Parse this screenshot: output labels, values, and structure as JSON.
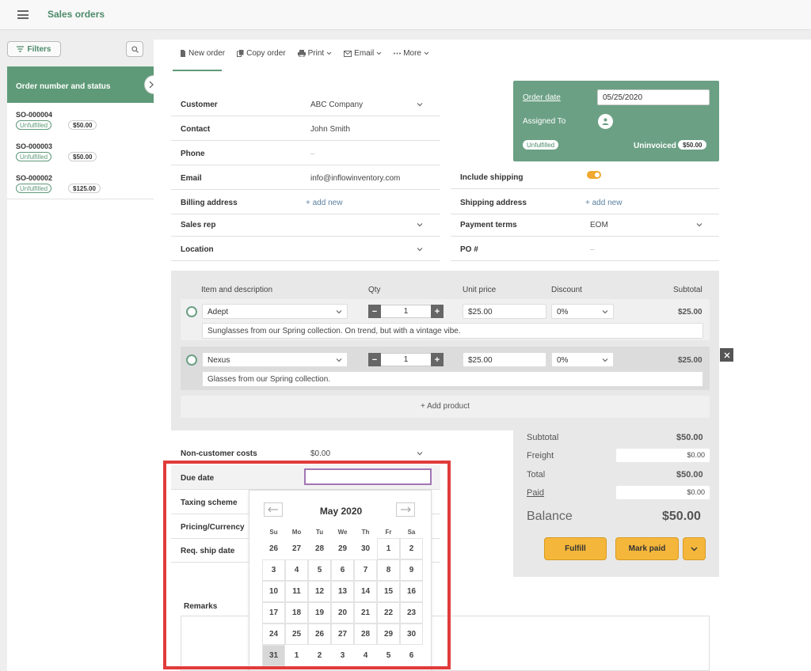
{
  "app": {
    "title": "Sales orders"
  },
  "sidebar": {
    "filters_label": "Filters",
    "list_header": "Order number and status",
    "orders": [
      {
        "number": "SO-000004",
        "status": "Unfulfilled",
        "amount": "$50.00"
      },
      {
        "number": "SO-000003",
        "status": "Unfulfilled",
        "amount": "$50.00"
      },
      {
        "number": "SO-000002",
        "status": "Unfulfilled",
        "amount": "$125.00"
      }
    ]
  },
  "toolbar": {
    "new_order": "New order",
    "copy_order": "Copy order",
    "print": "Print",
    "email": "Email",
    "more": "More"
  },
  "form": {
    "customer_label": "Customer",
    "customer_value": "ABC Company",
    "contact_label": "Contact",
    "contact_value": "John Smith",
    "phone_label": "Phone",
    "phone_value": "–",
    "email_label": "Email",
    "email_value": "info@inflowinventory.com",
    "billing_label": "Billing address",
    "billing_value": "+ add new",
    "salesrep_label": "Sales rep",
    "location_label": "Location",
    "include_shipping_label": "Include shipping",
    "shipping_label": "Shipping address",
    "shipping_value": "+ add new",
    "payment_terms_label": "Payment terms",
    "payment_terms_value": "EOM",
    "po_label": "PO #",
    "po_value": "–"
  },
  "order_box": {
    "order_date_label": "Order date",
    "order_date_value": "05/25/2020",
    "assigned_label": "Assigned To",
    "status": "Unfulfilled",
    "invoice_status": "Uninvoiced",
    "amount": "$50.00"
  },
  "items": {
    "headers": {
      "item": "Item and description",
      "qty": "Qty",
      "unit_price": "Unit price",
      "discount": "Discount",
      "subtotal": "Subtotal"
    },
    "lines": [
      {
        "name": "Adept",
        "qty": "1",
        "price": "$25.00",
        "discount": "0%",
        "subtotal": "$25.00",
        "description": "Sunglasses from our Spring collection. On trend, but with a vintage vibe."
      },
      {
        "name": "Nexus",
        "qty": "1",
        "price": "$25.00",
        "discount": "0%",
        "subtotal": "$25.00",
        "description": "Glasses from our Spring collection."
      }
    ],
    "add_product": "+ Add product"
  },
  "lower": {
    "noncust_label": "Non-customer costs",
    "noncust_value": "$0.00",
    "due_label": "Due date",
    "taxing_label": "Taxing scheme",
    "pricing_label": "Pricing/Currency",
    "reqship_label": "Req. ship date",
    "remarks_label": "Remarks"
  },
  "totals": {
    "subtotal_label": "Subtotal",
    "subtotal_value": "$50.00",
    "freight_label": "Freight",
    "freight_value": "$0.00",
    "total_label": "Total",
    "total_value": "$50.00",
    "paid_label": "Paid",
    "paid_value": "$0.00",
    "balance_label": "Balance",
    "balance_value": "$50.00",
    "fulfill": "Fulfill",
    "mark_paid": "Mark paid"
  },
  "calendar": {
    "title": "May 2020",
    "weekdays": [
      "Su",
      "Mo",
      "Tu",
      "We",
      "Th",
      "Fr",
      "Sa"
    ],
    "days": [
      "26",
      "27",
      "28",
      "29",
      "30",
      "1",
      "2",
      "3",
      "4",
      "5",
      "6",
      "7",
      "8",
      "9",
      "10",
      "11",
      "12",
      "13",
      "14",
      "15",
      "16",
      "17",
      "18",
      "19",
      "20",
      "21",
      "22",
      "23",
      "24",
      "25",
      "26",
      "27",
      "28",
      "29",
      "30",
      "31",
      "1",
      "2",
      "3",
      "4",
      "5",
      "6"
    ],
    "selected_index": 35,
    "month_start_index": 5,
    "month_end_index": 35
  },
  "colors": {
    "brand_green": "#5e9a78",
    "accent_yellow": "#f5b73b",
    "highlight_red": "#e13b3b",
    "focus_purple": "#a276b5"
  }
}
